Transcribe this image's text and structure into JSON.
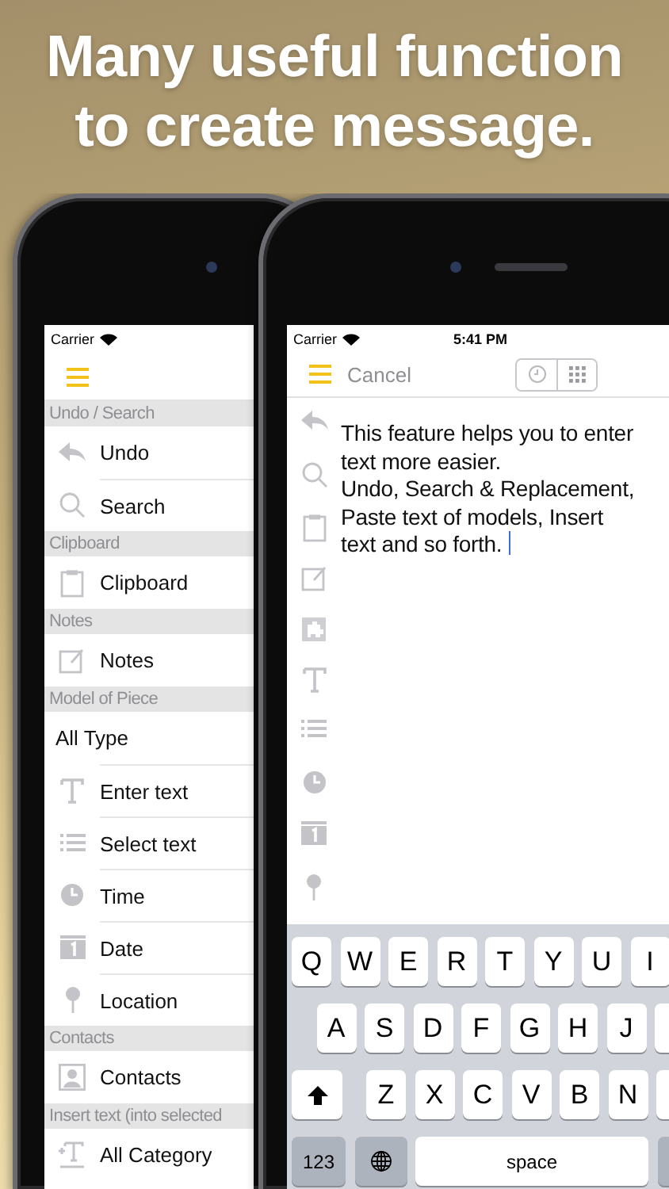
{
  "headline": {
    "lines": [
      "Many useful function",
      "to create message."
    ]
  },
  "menu_phone": {
    "carrier": "Carrier",
    "sections": [
      {
        "header": "Undo / Search",
        "items": [
          {
            "label": "Undo",
            "kind": "undo"
          },
          {
            "label": "Search",
            "kind": "search"
          }
        ]
      },
      {
        "header": "Clipboard",
        "items": [
          {
            "label": "Clipboard",
            "kind": "clipboard"
          }
        ]
      },
      {
        "header": "Notes",
        "items": [
          {
            "label": "Notes",
            "kind": "notes"
          }
        ]
      },
      {
        "header": "Model of Piece",
        "items": [
          {
            "label": "All Type",
            "kind": "plain"
          },
          {
            "label": "Enter text",
            "kind": "text"
          },
          {
            "label": "Select text",
            "kind": "list"
          },
          {
            "label": "Time",
            "kind": "time"
          },
          {
            "label": "Date",
            "kind": "date"
          },
          {
            "label": "Location",
            "kind": "location"
          }
        ]
      },
      {
        "header": "Contacts",
        "items": [
          {
            "label": "Contacts",
            "kind": "contacts"
          }
        ]
      },
      {
        "header": "Insert text (into selected",
        "items": [
          {
            "label": "All Category",
            "kind": "insert"
          }
        ]
      }
    ]
  },
  "editor_phone": {
    "carrier": "Carrier",
    "time": "5:41 PM",
    "cancel": "Cancel",
    "paragraphs": [
      "This feature helps you to enter text more easier.",
      "Undo, Search & Replacement, Paste text of models, Insert text and so forth."
    ],
    "keyboard": {
      "rows": [
        [
          "Q",
          "W",
          "E",
          "R",
          "T",
          "Y",
          "U",
          "I"
        ],
        [
          "A",
          "S",
          "D",
          "F",
          "G",
          "H",
          "J"
        ],
        [
          "Z",
          "X",
          "C",
          "V",
          "B",
          "N"
        ]
      ],
      "numbers": "123",
      "space": "space"
    }
  }
}
